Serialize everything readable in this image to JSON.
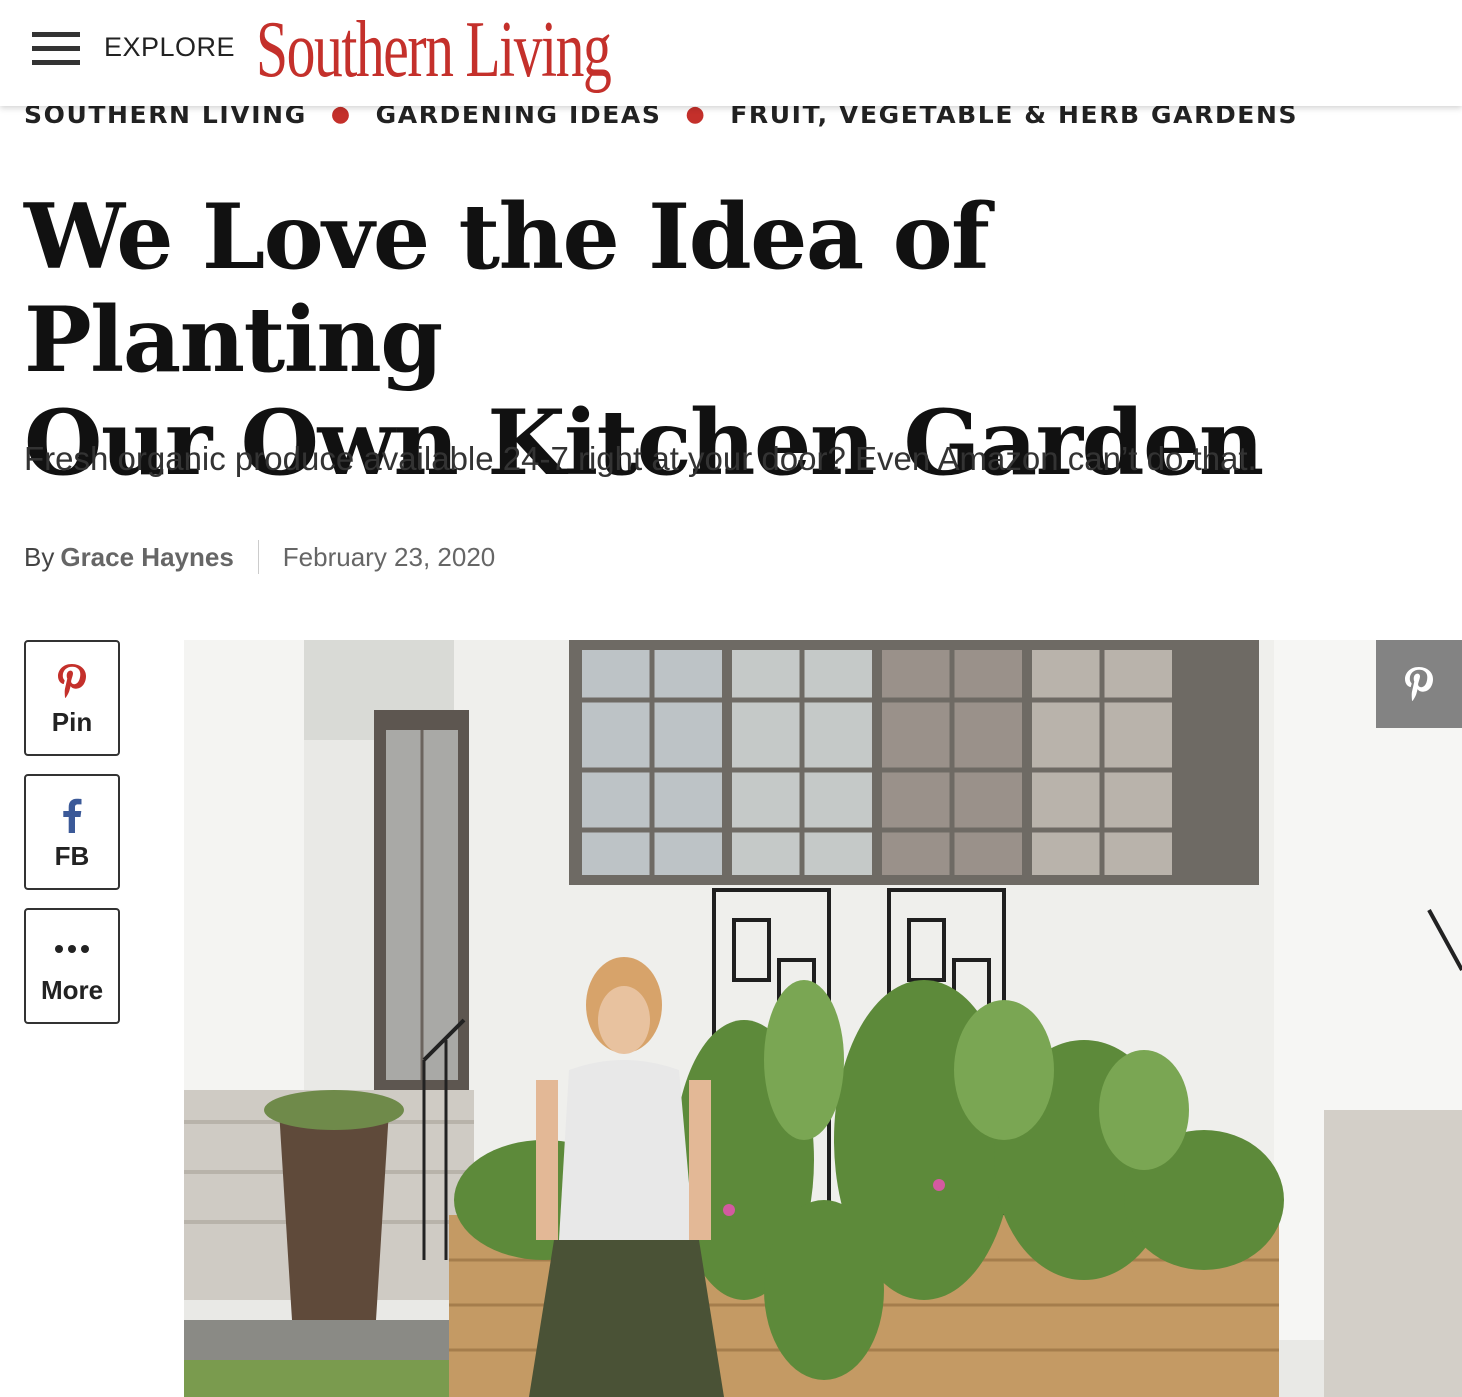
{
  "header": {
    "explore_label": "EXPLORE",
    "logo_text": "Southern Living",
    "brand_color": "#c4302b"
  },
  "breadcrumb": {
    "items": [
      "SOUTHERN LIVING",
      "GARDENING IDEAS",
      "FRUIT, VEGETABLE & HERB GARDENS"
    ]
  },
  "article": {
    "title_line1": "We Love the Idea of Planting",
    "title_line2": "Our Own Kitchen Garden",
    "dek": "Fresh organic produce available 24-7 right at your door? Even Amazon can’t do that.",
    "by_prefix": "By",
    "author": "Grace Haynes",
    "date": "February 23, 2020"
  },
  "social": {
    "pin_label": "Pin",
    "fb_label": "FB",
    "more_label": "More",
    "pin_icon": "pinterest-icon",
    "fb_icon": "facebook-icon",
    "more_icon": "ellipsis-icon"
  },
  "hero": {
    "image_icon": "garden-photo",
    "pin_overlay_icon": "pinterest-icon"
  }
}
